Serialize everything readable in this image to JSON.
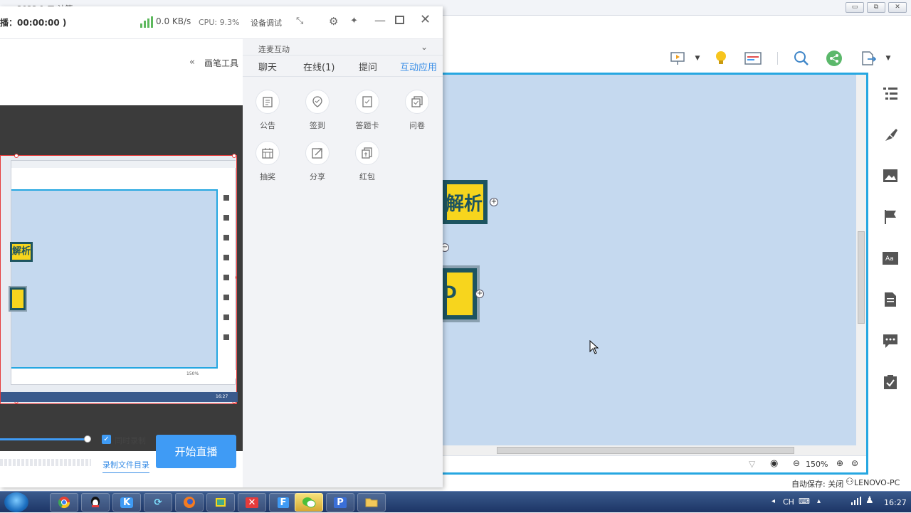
{
  "bg_app": {
    "title_fragment": "2022  1    三  计算 ",
    "win_controls": [
      "▭",
      "⧉",
      "✕"
    ],
    "zoom_label": "150%",
    "autosave": "自动保存: 关闭",
    "user": "LENOVO-PC",
    "node1_text": "解析",
    "node2_text": "D"
  },
  "live_panel": {
    "status_prefix": "播：00:00:00 )",
    "net_speed": "0.0 KB/s",
    "cpu": "CPU: 9.3%",
    "device_debug": "设备调试",
    "brush_tool": "画笔工具",
    "mic_section": "连麦互动",
    "tabs": [
      {
        "label": "聊天",
        "active": false
      },
      {
        "label": "在线(1)",
        "active": false
      },
      {
        "label": "提问",
        "active": false
      },
      {
        "label": "互动应用",
        "active": true
      }
    ],
    "apps": [
      {
        "label": "公告",
        "icon": "notice-icon"
      },
      {
        "label": "签到",
        "icon": "checkin-icon"
      },
      {
        "label": "答题卡",
        "icon": "answer-card-icon"
      },
      {
        "label": "问卷",
        "icon": "survey-icon"
      },
      {
        "label": "抽奖",
        "icon": "lottery-icon"
      },
      {
        "label": "分享",
        "icon": "share-icon"
      },
      {
        "label": "红包",
        "icon": "red-packet-icon"
      }
    ],
    "sync_record_label": "同时录制",
    "sync_record_checked": true,
    "record_dir_link": "录制文件目录",
    "start_live_button": "开始直播",
    "preview": {
      "node_text": "解析",
      "zoom": "150%",
      "user": "LENOVO-PC",
      "time": "16:27"
    }
  },
  "taskbar": {
    "apps": [
      "chrome",
      "qq",
      "k-app",
      "sync-app",
      "firefox",
      "window-app",
      "x-app",
      "f-app",
      "wechat",
      "p-app",
      "folder"
    ],
    "active_app": "wechat",
    "lang": "CH",
    "time": "16:27"
  },
  "colors": {
    "accent_blue": "#3f9bf5",
    "canvas_bg": "#c5d9ef",
    "node_yellow": "#f7d51d",
    "node_border": "#1d5460",
    "canvas_border": "#26a7e1"
  }
}
